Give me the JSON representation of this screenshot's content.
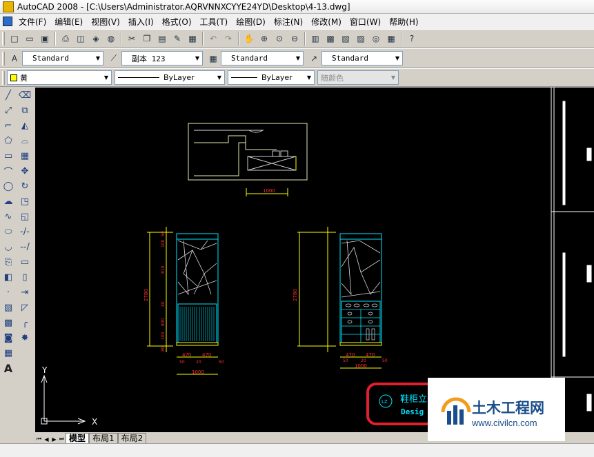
{
  "window": {
    "title": "AutoCAD 2008 - [C:\\Users\\Administrator.AQRVNNXCYYE24YD\\Desktop\\4-13.dwg]"
  },
  "menu": [
    "文件(F)",
    "编辑(E)",
    "视图(V)",
    "插入(I)",
    "格式(O)",
    "工具(T)",
    "绘图(D)",
    "标注(N)",
    "修改(M)",
    "窗口(W)",
    "帮助(H)"
  ],
  "styles_toolbar": {
    "text_style": "Standard",
    "dim_style": "副本 123",
    "table_style": "Standard",
    "multileader_style": "Standard"
  },
  "properties_toolbar": {
    "layer": "黄",
    "layer_color": "#ffff00",
    "linetype": "ByLayer",
    "lineweight": "ByLayer",
    "plot_style": "随颜色"
  },
  "drawing": {
    "top_dim": "1000",
    "left_overall_dim": "2780",
    "right_overall_dim": "2780",
    "left_width_dims": [
      "470",
      "470"
    ],
    "left_sub_dims": [
      "50",
      "20",
      "50"
    ],
    "left_total_width": "1000",
    "right_width_dims": [
      "470",
      "470"
    ],
    "right_sub_dims": [
      "50",
      "20",
      "50"
    ],
    "right_total_width": "1000",
    "left_vertical_dims": [
      "50",
      "100",
      "810",
      "40",
      "800",
      "100",
      "80"
    ],
    "title_block_text": "鞋柜立",
    "title_block_sub": "Desig",
    "ucs_x": "X",
    "ucs_y": "Y",
    "accent_cyan": "#00e5ff",
    "accent_yellow": "#ffff00",
    "highlight_red": "#e0202c"
  },
  "layout_tabs": [
    "模型",
    "布局1",
    "布局2"
  ],
  "watermark": {
    "title": "土木工程网",
    "url": "www.civilcn.com"
  }
}
